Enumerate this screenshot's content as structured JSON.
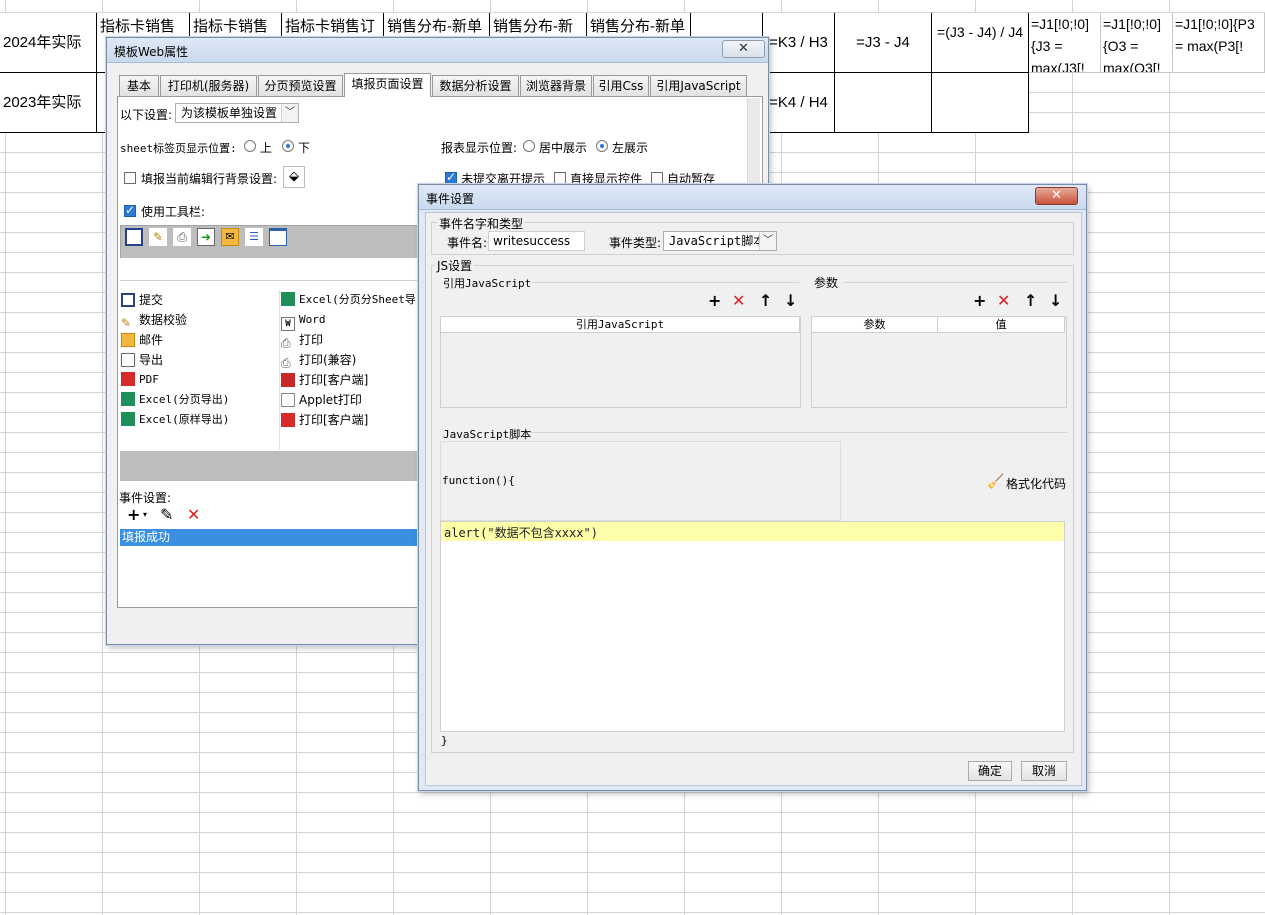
{
  "sheet": {
    "row1": {
      "label": "2024年实际",
      "cols": [
        "指标卡销售",
        "指标卡销售",
        "指标卡销售订",
        "销售分布-新单",
        "销售分布-新",
        "销售分布-新单"
      ],
      "formulas": [
        "=K3 / H3",
        "=J3 - J4",
        "=(J3 - J4) / J4",
        "=J1[!0;!0]{J3 = max(J3[!",
        "=J1[!0;!0]{O3 = max(O3[!",
        "=J1[!0;!0]{P3 = max(P3[!"
      ]
    },
    "row2": {
      "label": "2023年实际",
      "formulas": [
        "=K4 / H4"
      ]
    }
  },
  "web_attr": {
    "title": "模板Web属性",
    "close": "✕",
    "tabs": [
      "基本",
      "打印机(服务器)",
      "分页预览设置",
      "填报页面设置",
      "数据分析设置",
      "浏览器背景",
      "引用Css",
      "引用JavaScript"
    ],
    "active_tab": 3,
    "settings_label": "以下设置:",
    "settings_value": "为该模板单独设置",
    "sheet_tab_pos_label": "sheet标签页显示位置:",
    "sheet_tab_up": "上",
    "sheet_tab_down": "下",
    "report_pos_label": "报表显示位置:",
    "report_center": "居中展示",
    "report_left": "左展示",
    "fill_bg_label": "填报当前编辑行背景设置:",
    "unsubmitted_label": "未提交离开提示",
    "direct_show_label": "直接显示控件",
    "autosave_label": "自动暂存",
    "use_toolbar_label": "使用工具栏:",
    "list_left": [
      "提交",
      "数据校验",
      "邮件",
      "导出",
      "PDF",
      "Excel(分页导出)",
      "Excel(原样导出)"
    ],
    "list_right": [
      "Excel(分页分Sheet导出)",
      "Word",
      "打印",
      "打印(兼容)",
      "打印[客户端]",
      "Applet打印",
      "打印[客户端]"
    ],
    "events_label": "事件设置:",
    "event_item": "填报成功"
  },
  "event_dialog": {
    "title": "事件设置",
    "close": "✕",
    "group_name": "事件名字和类型",
    "event_name_label": "事件名:",
    "event_name_value": "writesuccess",
    "event_type_label": "事件类型:",
    "event_type_value": "JavaScript脚本",
    "js_group": "JS设置",
    "ref_js_label": "引用JavaScript",
    "params_label": "参数",
    "ref_js_header": "引用JavaScript",
    "param_header": "参数",
    "value_header": "值",
    "script_label": "JavaScript脚本",
    "func_open": "function(){",
    "format_code": "格式化代码",
    "code_line": "alert(\"数据不包含xxxx\")",
    "func_close": "}",
    "ok": "确定",
    "cancel": "取消"
  },
  "icons": {
    "add": "+",
    "delete": "✕",
    "up": "↑",
    "down": "↓",
    "edit": "✎"
  }
}
